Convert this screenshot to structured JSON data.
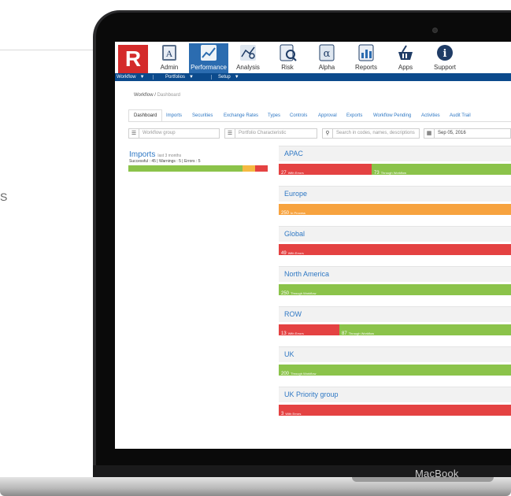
{
  "background": {
    "partial_text": "S"
  },
  "device": {
    "brand": "MacBook"
  },
  "colors": {
    "red": "#e44242",
    "green": "#8bc34a",
    "orange": "#f7a33f",
    "yellow": "#f5b942",
    "blue_bar": "#0b4a8c",
    "link": "#2f78c4"
  },
  "app": {
    "logo": "R",
    "modules": [
      {
        "label": "Admin",
        "icon": "admin-icon"
      },
      {
        "label": "Performance",
        "icon": "performance-chart-icon"
      },
      {
        "label": "Analysis",
        "icon": "analysis-icon"
      },
      {
        "label": "Risk",
        "icon": "risk-icon"
      },
      {
        "label": "Alpha",
        "icon": "alpha-icon"
      },
      {
        "label": "Reports",
        "icon": "reports-icon"
      },
      {
        "label": "Apps",
        "icon": "apps-basket-icon"
      },
      {
        "label": "Support",
        "icon": "support-info-icon"
      }
    ],
    "menubar": [
      {
        "label": "Workflow"
      },
      {
        "label": "Portfolios"
      },
      {
        "label": "Setup"
      }
    ]
  },
  "breadcrumb": {
    "root": "Workflow",
    "separator": "/",
    "current": "Dashboard"
  },
  "tabs": [
    "Dashboard",
    "Imports",
    "Securities",
    "Exchange Rates",
    "Types",
    "Controls",
    "Approval",
    "Exports",
    "Workflow Pending",
    "Activities",
    "Audit Trail"
  ],
  "filters": {
    "workflow_group_placeholder": "Workflow group",
    "portfolio_characteristic_placeholder": "Portfolio Characteristic",
    "search_placeholder": "Search in codes, names, descriptions",
    "date_value": "Sep 05, 2016"
  },
  "imports": {
    "title": "Imports",
    "period": "last 3 months",
    "stats": "Successful : 45 | Warnings : 5 | Errors : 5",
    "bar": [
      {
        "status": "successful",
        "value": 45,
        "color": "#8bc34a"
      },
      {
        "status": "warnings",
        "value": 5,
        "color": "#f5b942"
      },
      {
        "status": "errors",
        "value": 5,
        "color": "#e44242"
      }
    ]
  },
  "regions": [
    {
      "name": "APAC",
      "segments": [
        {
          "count": "27",
          "label": "With Errors",
          "color": "#e44242",
          "share": 0.4
        },
        {
          "count": "73",
          "label": "Through Workflow",
          "color": "#8bc34a",
          "share": 0.6
        }
      ]
    },
    {
      "name": "Europe",
      "segments": [
        {
          "count": "250",
          "label": "In Process",
          "color": "#f7a33f",
          "share": 1.0
        }
      ]
    },
    {
      "name": "Global",
      "segments": [
        {
          "count": "49",
          "label": "With Errors",
          "color": "#e44242",
          "share": 1.0
        }
      ]
    },
    {
      "name": "North America",
      "segments": [
        {
          "count": "250",
          "label": "Through Workflow",
          "color": "#8bc34a",
          "share": 1.0
        }
      ]
    },
    {
      "name": "ROW",
      "segments": [
        {
          "count": "13",
          "label": "With Errors",
          "color": "#e44242",
          "share": 0.26
        },
        {
          "count": "87",
          "label": "Through Workflow",
          "color": "#8bc34a",
          "share": 0.74
        }
      ]
    },
    {
      "name": "UK",
      "segments": [
        {
          "count": "200",
          "label": "Through Workflow",
          "color": "#8bc34a",
          "share": 1.0
        }
      ]
    },
    {
      "name": "UK Priority group",
      "segments": [
        {
          "count": "3",
          "label": "With Errors",
          "color": "#e44242",
          "share": 1.0
        }
      ]
    }
  ]
}
